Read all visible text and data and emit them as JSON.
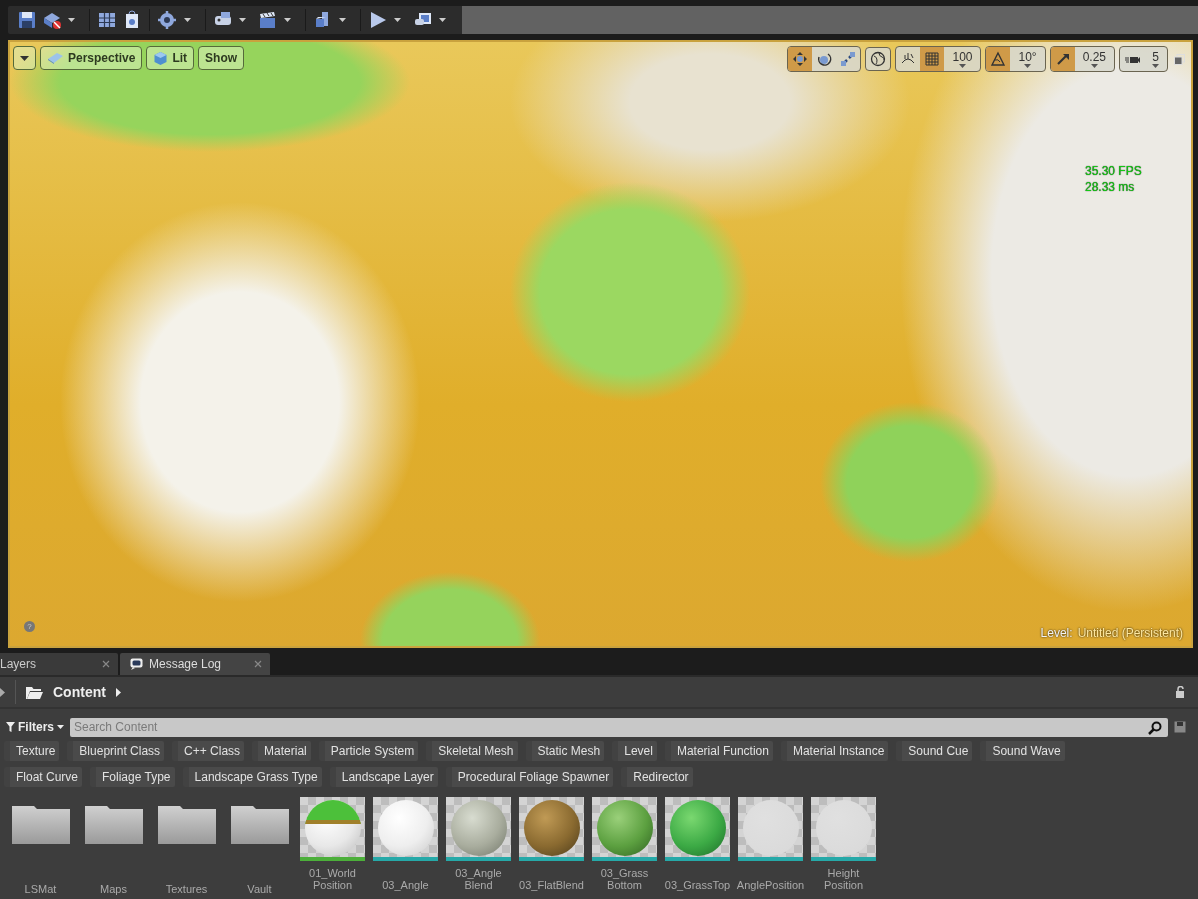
{
  "toolbar": [
    {
      "kind": "save",
      "menu": false
    },
    {
      "kind": "source",
      "menu": true
    },
    {
      "kind": "content",
      "menu": false
    },
    {
      "kind": "market",
      "menu": false
    },
    {
      "kind": "settings",
      "menu": true
    },
    {
      "kind": "blueprints",
      "menu": true
    },
    {
      "kind": "cinematics",
      "menu": true
    },
    {
      "kind": "build",
      "menu": true
    },
    {
      "kind": "play",
      "menu": true
    },
    {
      "kind": "launch",
      "menu": true
    }
  ],
  "viewport": {
    "buttons": [
      {
        "kind": "menu"
      },
      {
        "kind": "camera",
        "label": "Perspective"
      },
      {
        "kind": "lit",
        "label": "Lit"
      },
      {
        "kind": "plain",
        "label": "Show"
      }
    ],
    "transform_tools": [
      {
        "kind": "move",
        "selected": true
      },
      {
        "kind": "rotate",
        "selected": false
      },
      {
        "kind": "scale",
        "selected": false
      }
    ],
    "snaps": [
      {
        "kind": "grid",
        "on": true,
        "value": "100"
      },
      {
        "kind": "angle",
        "on": true,
        "value": "10°"
      },
      {
        "kind": "scale",
        "on": true,
        "value": "0.25"
      },
      {
        "kind": "camera",
        "on": false,
        "value": "5"
      }
    ],
    "stats": [
      "35.30 FPS",
      "28.33 ms"
    ],
    "help": "?",
    "level_label": "Level:",
    "level_name": "Untitled (Persistent)"
  },
  "tabs": [
    {
      "label": "Layers",
      "selected": false,
      "icon": false
    },
    {
      "label": "Message Log",
      "selected": true,
      "icon": true
    }
  ],
  "content_browser": {
    "path": "Content",
    "search": {
      "placeholder": "Search Content"
    },
    "filters_label": "Filters",
    "filter_chips": [
      [
        "Texture",
        "Blueprint Class",
        "C++ Class",
        "Material",
        "Particle System",
        "Skeletal Mesh",
        "Static Mesh",
        "Level",
        "Material Function",
        "Material Instance",
        "Sound Cue",
        "Sound Wave"
      ],
      [
        "Float Curve",
        "Foliage Type",
        "Landscape Grass Type",
        "Landscape Layer",
        "Procedural Foliage Spawner",
        "Redirector"
      ]
    ],
    "assets": [
      {
        "kind": "folder",
        "name": "LSMat"
      },
      {
        "kind": "folder",
        "name": "Maps"
      },
      {
        "kind": "folder",
        "name": "Textures"
      },
      {
        "kind": "folder",
        "name": "Vault"
      },
      {
        "kind": "material",
        "name": "01_World Position",
        "color": "#4caf3a"
      },
      {
        "kind": "material",
        "name": "03_Angle",
        "color": "#26a9a8"
      },
      {
        "kind": "material",
        "name": "03_Angle Blend",
        "color": "#26a9a8"
      },
      {
        "kind": "material",
        "name": "03_FlatBlend",
        "color": "#26a9a8"
      },
      {
        "kind": "material",
        "name": "03_Grass Bottom",
        "color": "#26a9a8"
      },
      {
        "kind": "material",
        "name": "03_GrassTop",
        "color": "#26a9a8"
      },
      {
        "kind": "material",
        "name": "AnglePosition",
        "color": "#26a9a8"
      },
      {
        "kind": "material",
        "name": "Height Position",
        "color": "#26a9a8"
      }
    ]
  }
}
